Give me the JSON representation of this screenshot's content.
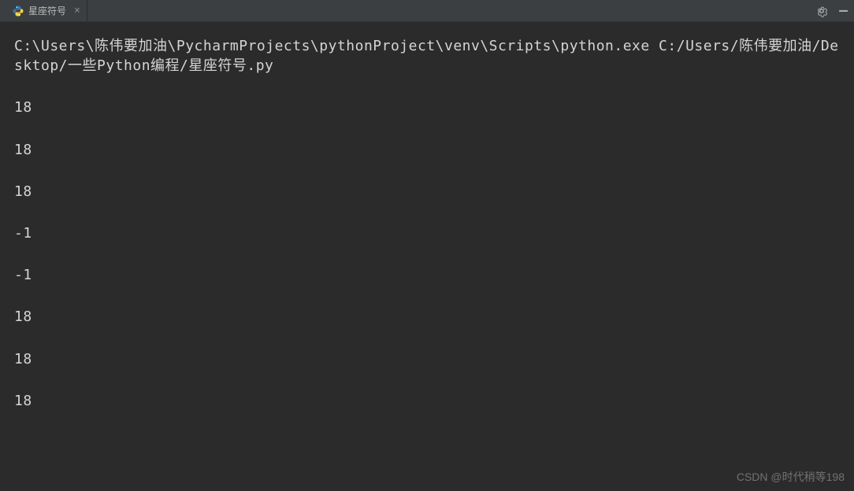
{
  "tab": {
    "title": "星座符号",
    "close_symbol": "×"
  },
  "titlebar": {
    "gear": "⚙",
    "minimize": "—"
  },
  "console": {
    "command": "C:\\Users\\陈伟要加油\\PycharmProjects\\pythonProject\\venv\\Scripts\\python.exe C:/Users/陈伟要加油/Desktop/一些Python编程/星座符号.py",
    "output": [
      "18",
      "18",
      "18",
      "-1",
      "-1",
      "18",
      "18",
      "18"
    ]
  },
  "watermark": "CSDN @时代稍等198"
}
